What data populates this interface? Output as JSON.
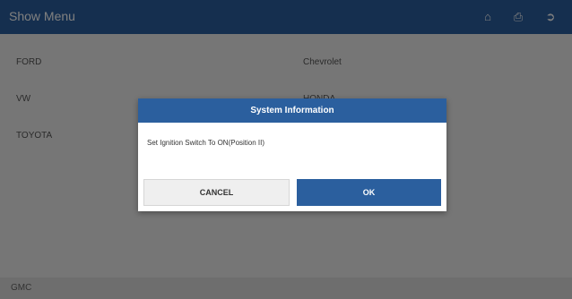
{
  "header": {
    "title": "Show Menu",
    "icons": [
      "home-icon",
      "print-icon",
      "exit-icon"
    ]
  },
  "breadcrumb": "",
  "brands": {
    "left": [
      "FORD",
      "VW",
      "TOYOTA"
    ],
    "right": [
      "Chevrolet",
      "HONDA"
    ]
  },
  "footer": {
    "code": "GMC"
  },
  "dialog": {
    "title": "System Information",
    "message": "Set Ignition Switch To ON(Position II)",
    "cancel_label": "CANCEL",
    "ok_label": "OK"
  },
  "colors": {
    "header": "#2b5f9e",
    "accent": "#2b5f9e",
    "breadcrumb": "#c74a2c"
  }
}
